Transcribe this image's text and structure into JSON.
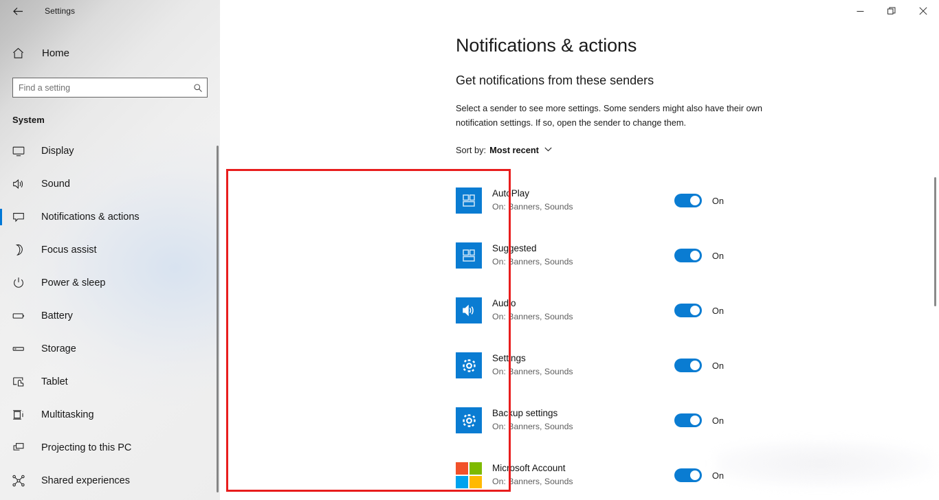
{
  "window": {
    "title": "Settings",
    "back_icon": "back-arrow-icon",
    "controls": [
      {
        "name": "minimize",
        "glyph": "minimize-icon"
      },
      {
        "name": "restore",
        "glyph": "restore-icon"
      },
      {
        "name": "close",
        "glyph": "close-icon"
      }
    ]
  },
  "sidebar": {
    "home_label": "Home",
    "home_icon": "home-icon",
    "search": {
      "placeholder": "Find a setting",
      "value": "",
      "icon": "search-icon"
    },
    "section_header": "System",
    "items": [
      {
        "label": "Display",
        "icon": "monitor-icon",
        "active": false
      },
      {
        "label": "Sound",
        "icon": "speaker-icon",
        "active": false
      },
      {
        "label": "Notifications & actions",
        "icon": "chat-bubble-icon",
        "active": true
      },
      {
        "label": "Focus assist",
        "icon": "moon-icon",
        "active": false
      },
      {
        "label": "Power & sleep",
        "icon": "power-icon",
        "active": false
      },
      {
        "label": "Battery",
        "icon": "battery-icon",
        "active": false
      },
      {
        "label": "Storage",
        "icon": "drive-icon",
        "active": false
      },
      {
        "label": "Tablet",
        "icon": "tablet-touch-icon",
        "active": false
      },
      {
        "label": "Multitasking",
        "icon": "multitasking-icon",
        "active": false
      },
      {
        "label": "Projecting to this PC",
        "icon": "project-screen-icon",
        "active": false
      },
      {
        "label": "Shared experiences",
        "icon": "share-nodes-icon",
        "active": false
      }
    ]
  },
  "main": {
    "page_title": "Notifications & actions",
    "group_title": "Get notifications from these senders",
    "description": "Select a sender to see more settings. Some senders might also have their own notification settings. If so, open the sender to change them.",
    "sort": {
      "label": "Sort by:",
      "value": "Most recent",
      "chevron_icon": "chevron-down-icon"
    },
    "senders": [
      {
        "name": "AutoPlay",
        "status_detail": "On: Banners, Sounds",
        "toggle": "on",
        "toggle_label": "On",
        "icon": "tiles-icon"
      },
      {
        "name": "Suggested",
        "status_detail": "On: Banners, Sounds",
        "toggle": "on",
        "toggle_label": "On",
        "icon": "tiles-icon"
      },
      {
        "name": "Audio",
        "status_detail": "On: Banners, Sounds",
        "toggle": "on",
        "toggle_label": "On",
        "icon": "speaker-icon"
      },
      {
        "name": "Settings",
        "status_detail": "On: Banners, Sounds",
        "toggle": "on",
        "toggle_label": "On",
        "icon": "gear-icon"
      },
      {
        "name": "Backup settings",
        "status_detail": "On: Banners, Sounds",
        "toggle": "on",
        "toggle_label": "On",
        "icon": "gear-icon"
      },
      {
        "name": "Microsoft Account",
        "status_detail": "On: Banners, Sounds",
        "toggle": "on",
        "toggle_label": "On",
        "icon": "windows-logo-icon"
      }
    ]
  },
  "annotation": {
    "shape": "rectangle",
    "color": "#e81d1d"
  },
  "colors": {
    "accent": "#0a7cd2",
    "selection_bar": "#0078d7",
    "annotation_red": "#e81d1d",
    "ms_logo_red": "#f1512a",
    "ms_logo_green": "#7eba00",
    "ms_logo_blue": "#00a3ee",
    "ms_logo_yellow": "#ffb901"
  }
}
